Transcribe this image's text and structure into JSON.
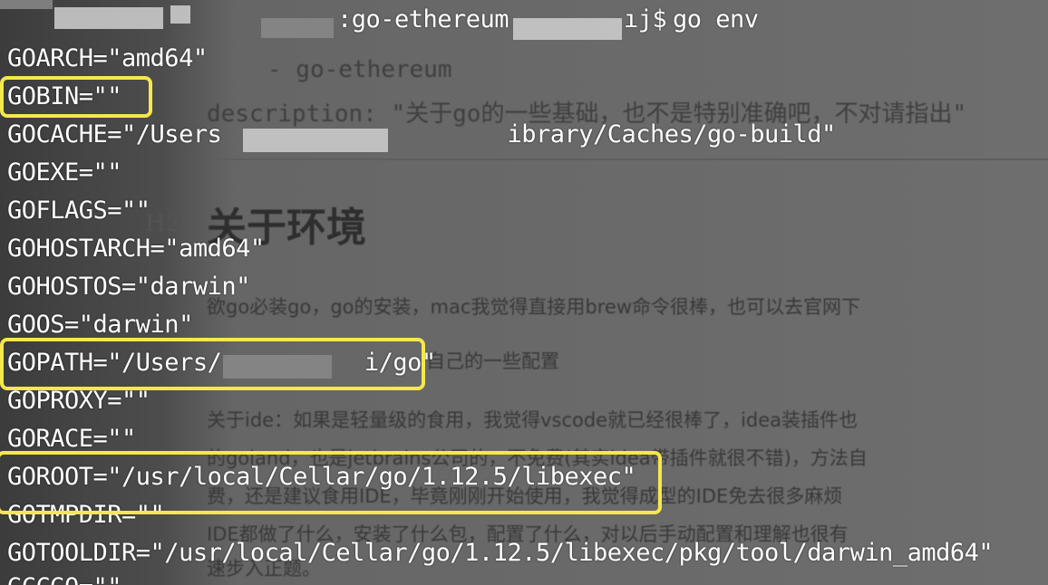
{
  "terminal": {
    "prompt_host": ":go-ethereum",
    "prompt_suffix": "ıj$",
    "command": "go env",
    "env_lines": [
      "GOARCH=\"amd64\"",
      "GOBIN=\"\"",
      "GOCACHE=\"/Users                    ibrary/Caches/go-build\"",
      "GOEXE=\"\"",
      "GOFLAGS=\"\"",
      "GOHOSTARCH=\"amd64\"",
      "GOHOSTOS=\"darwin\"",
      "GOOS=\"darwin\"",
      "GOPATH=\"/Users/          i/go\"",
      "GOPROXY=\"\"",
      "GORACE=\"\"",
      "GOROOT=\"/usr/local/Cellar/go/1.12.5/libexec\"",
      "GOTMPDIR=\"\"",
      "GOTOOLDIR=\"/usr/local/Cellar/go/1.12.5/libexec/pkg/tool/darwin_amd64\"",
      "GCCGO=\"\""
    ],
    "highlighted": [
      "GOBIN",
      "GOPATH",
      "GOROOT"
    ],
    "highlight_color": "#f5e84a",
    "text_color": "#ffffff"
  },
  "background_editor": {
    "tag_line": "- go-ethereum",
    "description_line": "description: \"关于go的一些基础，也不是特别准确吧，不对请指出\"",
    "heading": "关于环境",
    "heading_marker": "H2",
    "paragraph_1": "欲go必装go，go的安装，mac我觉得直接用brew命令很棒，也可以去官网下",
    "paragraph_2": "自己的一些配置",
    "paragraph_3": "关于ide：如果是轻量级的食用，我觉得vscode就已经很棒了，idea装插件也",
    "paragraph_4": "的goland，也是jetbrains公司的，不免费(其实idea带插件就很不错)，方法自",
    "paragraph_5": "费，还是建议食用IDE，毕竟刚刚开始使用，我觉得成型的IDE免去很多麻烦",
    "paragraph_6": "IDE都做了什么，安装了什么包，配置了什么，对以后手动配置和理解也很有",
    "paragraph_7": "速步入正题。"
  }
}
